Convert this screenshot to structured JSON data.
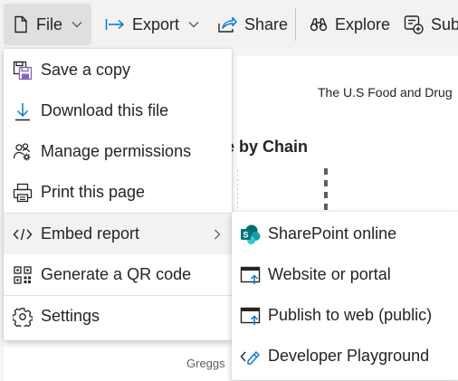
{
  "toolbar": {
    "file_label": "File",
    "export_label": "Export",
    "share_label": "Share",
    "explore_label": "Explore",
    "subscribe_label": "Sub"
  },
  "report": {
    "subtitle": "The U.S Food and Drug",
    "visual_title": "ne by Chain",
    "axis_label": "Greggs"
  },
  "file_menu": {
    "items": [
      {
        "label": "Save a copy",
        "icon": "save-copy-icon"
      },
      {
        "label": "Download this file",
        "icon": "download-icon"
      },
      {
        "label": "Manage permissions",
        "icon": "manage-permissions-icon"
      },
      {
        "label": "Print this page",
        "icon": "print-icon"
      },
      {
        "label": "Embed report",
        "icon": "embed-code-icon",
        "has_submenu": true,
        "active": true
      },
      {
        "label": "Generate a QR code",
        "icon": "qr-code-icon"
      },
      {
        "label": "Settings",
        "icon": "settings-gear-icon"
      }
    ]
  },
  "embed_submenu": {
    "items": [
      {
        "label": "SharePoint online",
        "icon": "sharepoint-icon"
      },
      {
        "label": "Website or portal",
        "icon": "website-icon"
      },
      {
        "label": "Publish to web (public)",
        "icon": "publish-web-icon"
      },
      {
        "label": "Developer Playground",
        "icon": "developer-playground-icon"
      }
    ]
  },
  "colors": {
    "toolbar_bg": "#f3f2f1",
    "active_bg": "#e1dfdd",
    "text": "#252423",
    "sharepoint": "#038387",
    "accent_blue": "#0078d4",
    "save_purple": "#8764b8"
  }
}
